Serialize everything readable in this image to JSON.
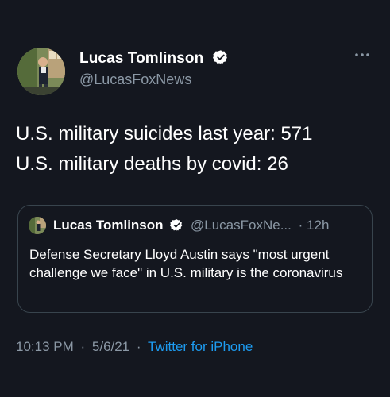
{
  "author": {
    "name": "Lucas Tomlinson",
    "handle": "@LucasFoxNews",
    "verified_color": "#ffffff"
  },
  "body": {
    "lines": [
      "U.S. military suicides last year: 571",
      "U.S. military deaths by covid: 26"
    ]
  },
  "quoted_tweet": {
    "name": "Lucas Tomlinson",
    "handle": "@LucasFoxNe...",
    "separator": "·",
    "time": "12h",
    "text": "Defense Secretary Lloyd Austin says \"most urgent challenge we face\" in U.S. military is the coronavirus"
  },
  "meta": {
    "time": "10:13 PM",
    "date": "5/6/21",
    "separator": "·",
    "source": "Twitter for iPhone"
  },
  "icons": {
    "more": "more-options-icon",
    "verified": "verified-badge-icon"
  },
  "colors": {
    "background": "#14171f",
    "secondary_text": "#8b98a5",
    "link": "#1d9bf0",
    "border": "#38444d"
  }
}
